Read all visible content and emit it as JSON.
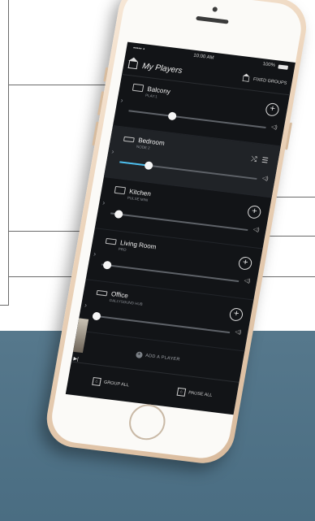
{
  "status": {
    "carrier": "••••• •",
    "time": "10:00 AM",
    "battery": "100%"
  },
  "header": {
    "title": "My Players",
    "fixed_groups": "FIXED GROUPS"
  },
  "players": [
    {
      "name": "Balcony",
      "model": "PLAY:1",
      "volume": 0.32,
      "action": "+",
      "active": false
    },
    {
      "name": "Bedroom",
      "model": "NODE 2",
      "volume": 0.21,
      "action": "controls",
      "active": true
    },
    {
      "name": "Kitchen",
      "model": "PULSE MINI",
      "volume": 0.06,
      "action": "+",
      "active": false
    },
    {
      "name": "Living Room",
      "model": "PRO",
      "volume": 0.04,
      "action": "+",
      "active": false
    },
    {
      "name": "Office",
      "model": "GALLYSOUND HUB",
      "volume": 0.03,
      "action": "+",
      "active": false
    }
  ],
  "add_player": "ADD A PLAYER",
  "footer": {
    "group_all": "GROUP ALL",
    "pause_all": "PAUSE ALL"
  },
  "icons": {
    "home": "house-icon",
    "chevron": "chevron-right-icon",
    "plus": "plus-circle-icon",
    "speaker": "speaker-icon"
  },
  "colors": {
    "accent": "#4bc1f2",
    "screen_bg": "#121417",
    "teal_bg": "#56788c"
  }
}
